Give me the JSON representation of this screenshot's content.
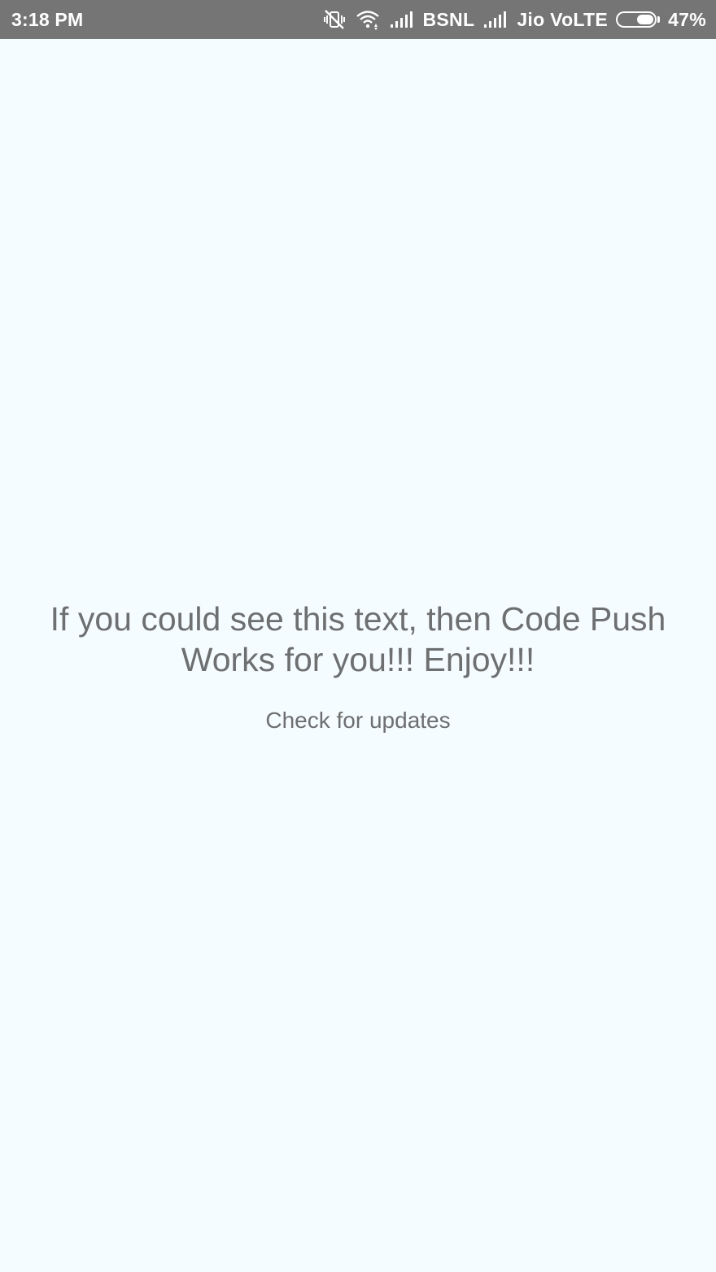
{
  "status_bar": {
    "time": "3:18 PM",
    "carrier1": "BSNL",
    "carrier2": "Jio VoLTE",
    "battery_percent_label": "47%",
    "battery_level": 0.47,
    "icons": [
      "vibrate-off-icon",
      "wifi-icon",
      "signal-icon",
      "signal-icon",
      "battery-icon"
    ],
    "background_color": "#757575"
  },
  "main": {
    "message": "If you could see this text, then Code Push Works for you!!! Enjoy!!!",
    "check_updates_label": "Check for updates",
    "background_color": "#F5FCFF",
    "text_color": "#6d6f70"
  }
}
